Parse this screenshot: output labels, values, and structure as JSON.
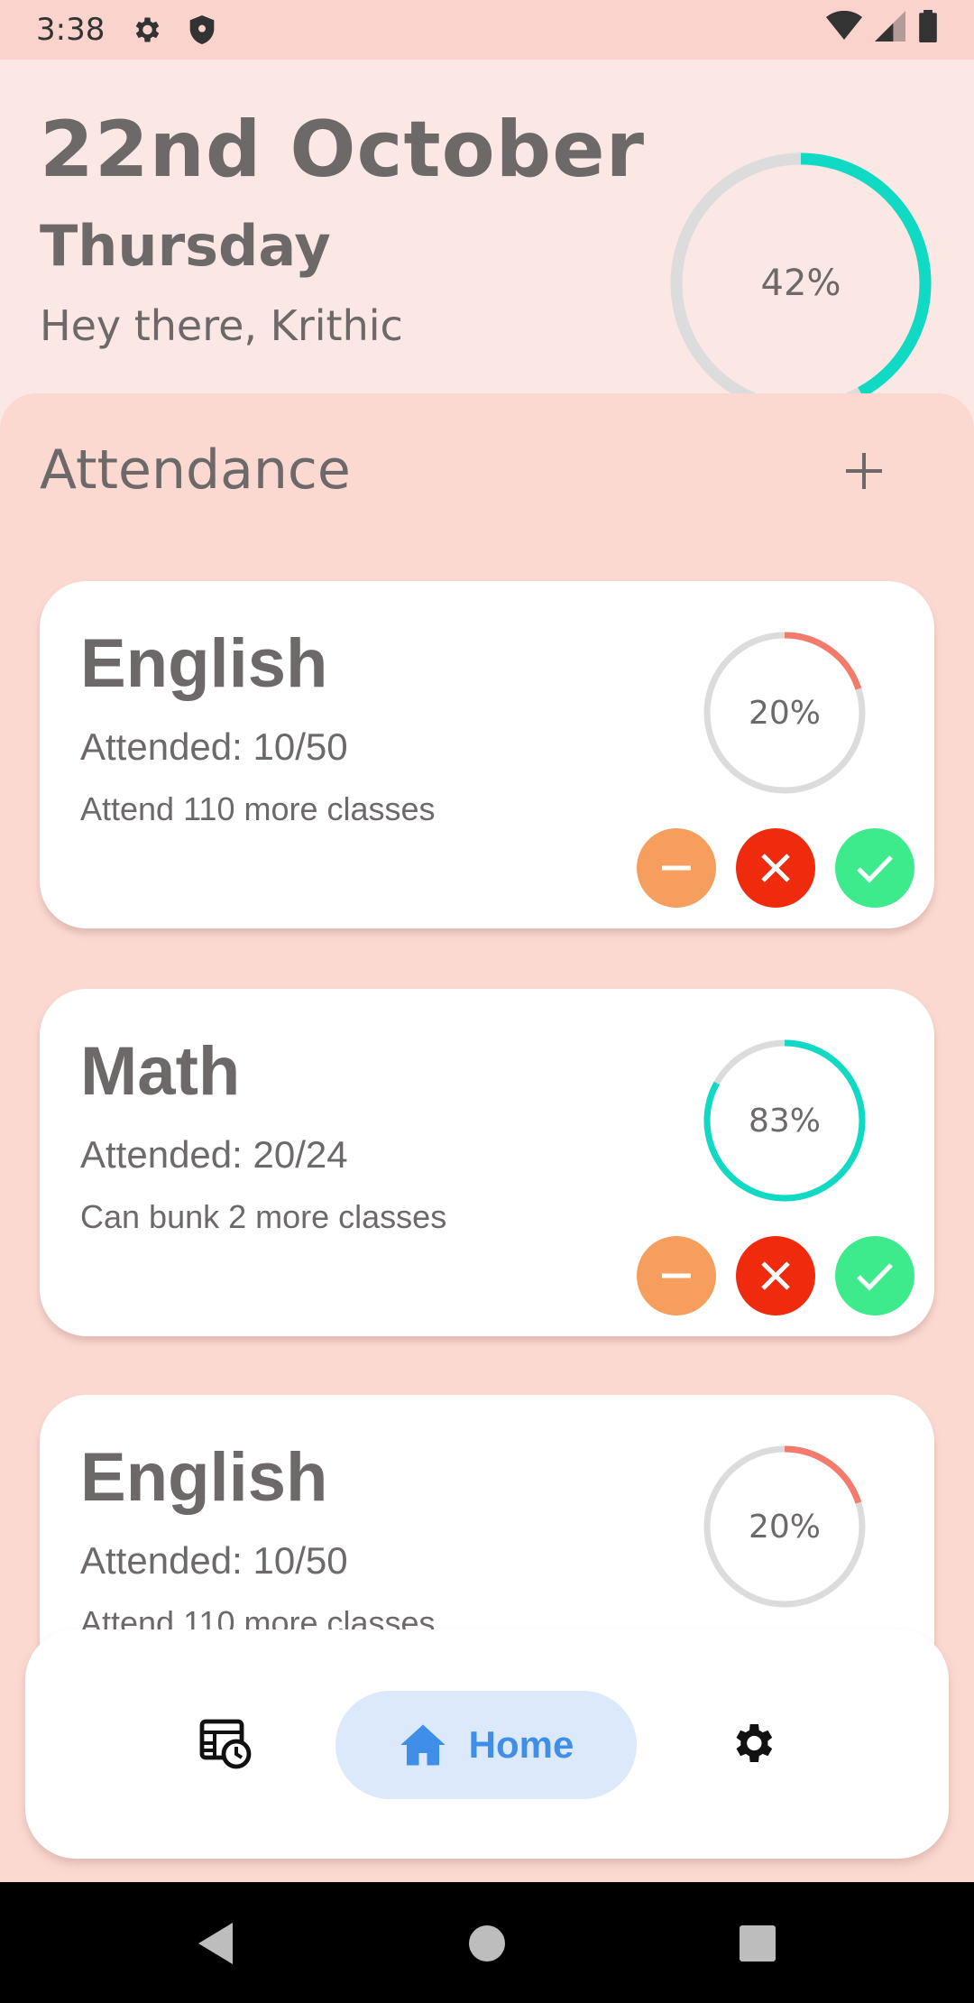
{
  "status_bar": {
    "time": "3:38"
  },
  "header": {
    "date": "22nd October",
    "weekday": "Thursday",
    "greeting": "Hey there, Krithic",
    "overall_percent_label": "42%",
    "overall_percent": 42,
    "ring_color": "#10d9c4",
    "track_color": "#dcdcdc"
  },
  "attendance": {
    "title": "Attendance",
    "add_label": "+",
    "cards": [
      {
        "subject": "English",
        "attended": "Attended: 10/50",
        "hint": "Attend 110 more classes",
        "percent_label": "20%",
        "percent": 20,
        "ring_color": "#f47b6b"
      },
      {
        "subject": "Math",
        "attended": "Attended: 20/24",
        "hint": "Can bunk 2 more classes",
        "percent_label": "83%",
        "percent": 83,
        "ring_color": "#10d9c4"
      },
      {
        "subject": "English",
        "attended": "Attended: 10/50",
        "hint": "Attend 110 more classes",
        "percent_label": "20%",
        "percent": 20,
        "ring_color": "#f47b6b"
      }
    ]
  },
  "bottom_nav": {
    "items": [
      {
        "icon": "timetable-icon"
      },
      {
        "icon": "home-icon",
        "label": "Home",
        "active": true
      },
      {
        "icon": "settings-icon"
      }
    ]
  },
  "colors": {
    "minus": "#f59e5d",
    "absent": "#ef2a0d",
    "present": "#3deb8c",
    "home_active_bg": "#dbe9fb",
    "home_active_fg": "#3f8fe8"
  }
}
